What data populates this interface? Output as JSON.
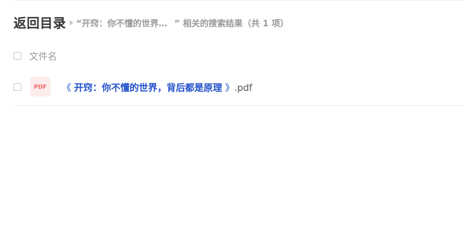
{
  "header": {
    "back_label": "返回目录",
    "search_query": "“开窍：你不懂的世界…",
    "search_suffix": "” 相关的搜索结果（共 1 项）"
  },
  "table": {
    "column_header": "文件名",
    "rows": [
      {
        "icon": "pdf-icon",
        "icon_label": "PDF",
        "open_bracket": "《 ",
        "title": "开窍：你不懂的世界，背后都是原理",
        "close_bracket": " 》",
        "extension": ".pdf"
      }
    ]
  },
  "colors": {
    "link_blue": "#1f4fc9",
    "pdf_red": "#ef6b6b",
    "muted_text": "#999999"
  }
}
